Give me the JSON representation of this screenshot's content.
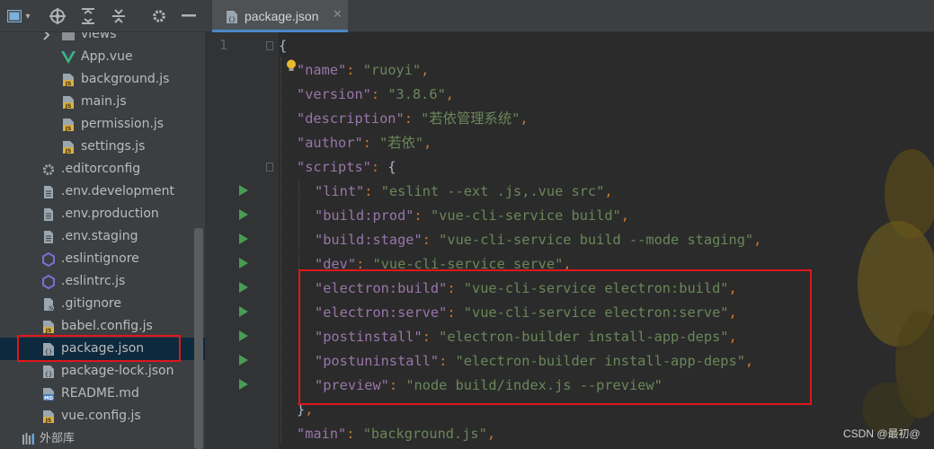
{
  "toolbar": {
    "icons": [
      "project-view-icon",
      "locate-icon",
      "expand-all-icon",
      "collapse-all-icon",
      "settings-icon",
      "hide-icon"
    ]
  },
  "tree": {
    "items": [
      {
        "label": "views",
        "icon": "folder",
        "indent": 1,
        "has_arrow": true
      },
      {
        "label": "App.vue",
        "icon": "vue",
        "indent": 2
      },
      {
        "label": "background.js",
        "icon": "js",
        "indent": 2
      },
      {
        "label": "main.js",
        "icon": "js",
        "indent": 2
      },
      {
        "label": "permission.js",
        "icon": "js",
        "indent": 2
      },
      {
        "label": "settings.js",
        "icon": "js",
        "indent": 2
      },
      {
        "label": ".editorconfig",
        "icon": "gear",
        "indent": 0
      },
      {
        "label": ".env.development",
        "icon": "text",
        "indent": 0
      },
      {
        "label": ".env.production",
        "icon": "text",
        "indent": 0
      },
      {
        "label": ".env.staging",
        "icon": "text",
        "indent": 0
      },
      {
        "label": ".eslintignore",
        "icon": "eslint",
        "indent": 0
      },
      {
        "label": ".eslintrc.js",
        "icon": "eslint",
        "indent": 0
      },
      {
        "label": ".gitignore",
        "icon": "ignore",
        "indent": 0
      },
      {
        "label": "babel.config.js",
        "icon": "js",
        "indent": 0
      },
      {
        "label": "package.json",
        "icon": "json",
        "indent": 0,
        "selected": true
      },
      {
        "label": "package-lock.json",
        "icon": "json",
        "indent": 0
      },
      {
        "label": "README.md",
        "icon": "md",
        "indent": 0
      },
      {
        "label": "vue.config.js",
        "icon": "js",
        "indent": 0
      },
      {
        "label": "外部库",
        "icon": "library",
        "indent": -1
      }
    ]
  },
  "editor": {
    "tab_label": "package.json",
    "line_number": "1",
    "lines": [
      [
        [
          "brace",
          "{"
        ]
      ],
      [
        [
          "k",
          "\"name\""
        ],
        [
          "p",
          ": "
        ],
        [
          "s",
          "\"ruoyi\""
        ],
        [
          "p",
          ","
        ]
      ],
      [
        [
          "k",
          "\"version\""
        ],
        [
          "p",
          ": "
        ],
        [
          "s",
          "\"3.8.6\""
        ],
        [
          "p",
          ","
        ]
      ],
      [
        [
          "k",
          "\"description\""
        ],
        [
          "p",
          ": "
        ],
        [
          "s",
          "\"若依管理系统\""
        ],
        [
          "p",
          ","
        ]
      ],
      [
        [
          "k",
          "\"author\""
        ],
        [
          "p",
          ": "
        ],
        [
          "s",
          "\"若依\""
        ],
        [
          "p",
          ","
        ]
      ],
      [
        [
          "k",
          "\"scripts\""
        ],
        [
          "p",
          ": "
        ],
        [
          "brace",
          "{"
        ]
      ],
      [
        [
          "k",
          "\"lint\""
        ],
        [
          "p",
          ": "
        ],
        [
          "s",
          "\"eslint --ext .js,.vue src\""
        ],
        [
          "p",
          ","
        ]
      ],
      [
        [
          "k",
          "\"build:prod\""
        ],
        [
          "p",
          ": "
        ],
        [
          "s",
          "\"vue-cli-service build\""
        ],
        [
          "p",
          ","
        ]
      ],
      [
        [
          "k",
          "\"build:stage\""
        ],
        [
          "p",
          ": "
        ],
        [
          "s",
          "\"vue-cli-service build --mode staging\""
        ],
        [
          "p",
          ","
        ]
      ],
      [
        [
          "k",
          "\"dev\""
        ],
        [
          "p",
          ": "
        ],
        [
          "s",
          "\"vue-cli-service serve\""
        ],
        [
          "p",
          ","
        ]
      ],
      [
        [
          "k",
          "\"electron:build\""
        ],
        [
          "p",
          ": "
        ],
        [
          "s",
          "\"vue-cli-service electron:build\""
        ],
        [
          "p",
          ","
        ]
      ],
      [
        [
          "k",
          "\"electron:serve\""
        ],
        [
          "p",
          ": "
        ],
        [
          "s",
          "\"vue-cli-service electron:serve\""
        ],
        [
          "p",
          ","
        ]
      ],
      [
        [
          "k",
          "\"postinstall\""
        ],
        [
          "p",
          ": "
        ],
        [
          "s",
          "\"electron-builder install-app-deps\""
        ],
        [
          "p",
          ","
        ]
      ],
      [
        [
          "k",
          "\"postuninstall\""
        ],
        [
          "p",
          ": "
        ],
        [
          "s",
          "\"electron-builder install-app-deps\""
        ],
        [
          "p",
          ","
        ]
      ],
      [
        [
          "k",
          "\"preview\""
        ],
        [
          "p",
          ": "
        ],
        [
          "s",
          "\"node build/index.js --preview\""
        ]
      ],
      [
        [
          "brace",
          "}"
        ],
        [
          "p",
          ","
        ]
      ],
      [
        [
          "k",
          "\"main\""
        ],
        [
          "p",
          ": "
        ],
        [
          "s",
          "\"background.js\""
        ],
        [
          "p",
          ","
        ]
      ]
    ],
    "indents": [
      0,
      1,
      1,
      1,
      1,
      1,
      2,
      2,
      2,
      2,
      2,
      2,
      2,
      2,
      2,
      1,
      1
    ]
  },
  "watermark": "CSDN @最初@",
  "colors": {
    "json_key": "#9876aa",
    "json_string": "#6a8759",
    "punctuation": "#cc7832",
    "run_marker": "#499c54",
    "highlight_box": "#e0161c",
    "selection": "#0d293e"
  }
}
